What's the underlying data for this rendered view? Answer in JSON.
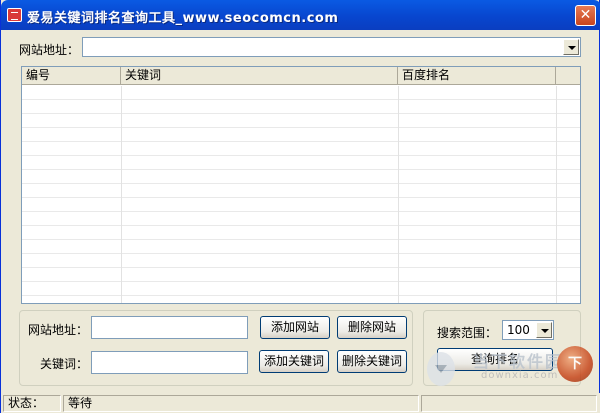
{
  "window": {
    "title": "爱易关键词排名查询工具_www.seocomcn.com",
    "close_glyph": "✕"
  },
  "site_bar": {
    "label": "网站地址：",
    "value": ""
  },
  "list": {
    "columns": [
      "编号",
      "关键词",
      "百度排名"
    ],
    "rows": []
  },
  "form": {
    "site_label": "网站地址：",
    "site_value": "",
    "keyword_label": "关键词：",
    "keyword_value": "",
    "add_site": "添加网站",
    "delete_site": "删除网站",
    "add_keyword": "添加关键词",
    "delete_keyword": "删除关键词"
  },
  "search": {
    "range_label": "搜索范围：",
    "range_value": "100",
    "query_button": "查询排名"
  },
  "status": {
    "label": "状态：",
    "value": "等待"
  },
  "watermark": {
    "text": "当下软件园",
    "url": "downxia.com",
    "logo": "下"
  },
  "colors": {
    "titlebar": "#0846cf",
    "window_bg": "#ece9d8",
    "border": "#7f9db9"
  }
}
